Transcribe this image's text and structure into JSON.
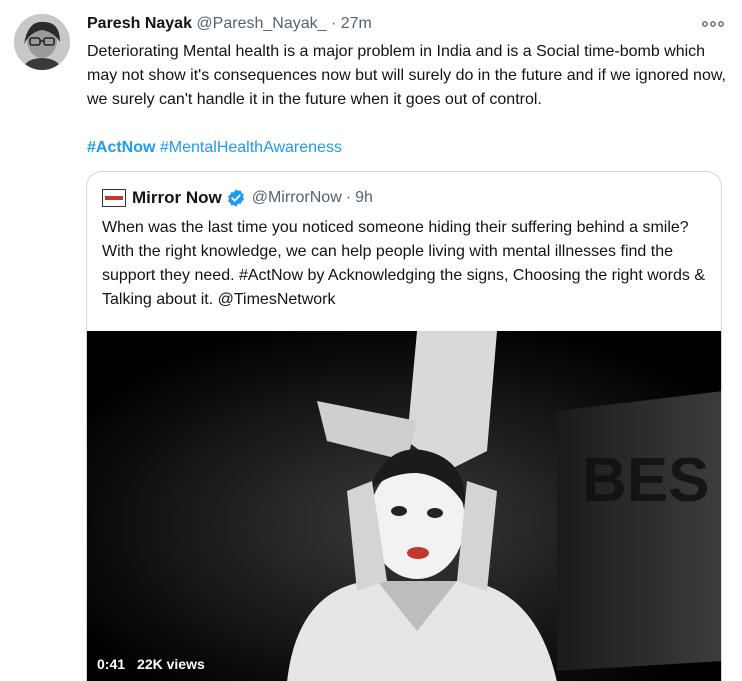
{
  "tweet": {
    "author_name": "Paresh Nayak",
    "handle": "@Paresh_Nayak_",
    "separator": "·",
    "time": "27m",
    "more_icon": "more-horizontal-icon",
    "text": "Deteriorating Mental health is a major problem in India and is a Social time-bomb which may not show it's consequences now but will surely do in the future and if we ignored now, we surely can't handle it in the future when it goes out of control.",
    "hashtags": [
      "#ActNow",
      "#MentalHealthAwareness"
    ]
  },
  "quote": {
    "author_name": "Mirror Now",
    "verified_icon": "verified-badge-icon",
    "handle": "@MirrorNow",
    "separator": "·",
    "time": "9h",
    "text": "When was the last time you noticed someone hiding their suffering behind a smile? With the right knowledge, we can help people living with mental illnesses find the support they need. #ActNow by Acknowledging the signs, Choosing the right words & Talking about it. @TimesNetwork",
    "video": {
      "duration": "0:41",
      "views": "22K views",
      "background_letters": "BES"
    }
  },
  "colors": {
    "link": "#1d9bf0",
    "secondary_text": "#536471",
    "border": "#cfd9de",
    "primary_text": "#0f1419"
  }
}
